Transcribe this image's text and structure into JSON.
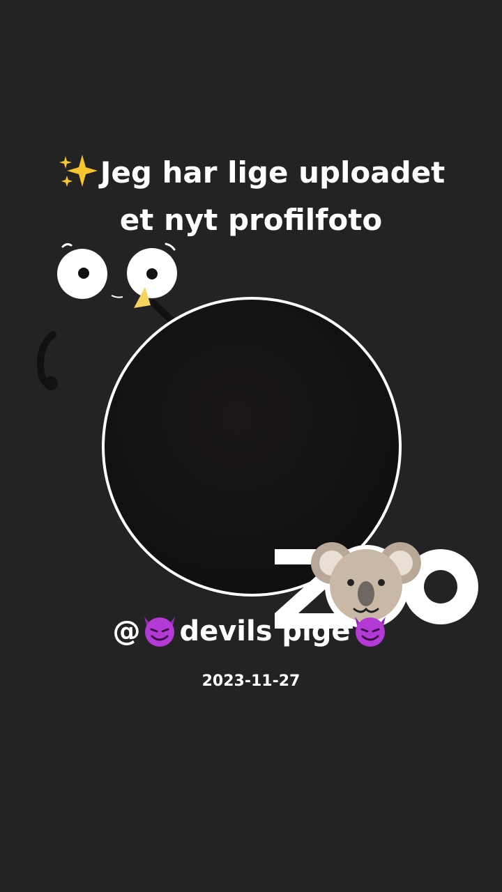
{
  "headline": {
    "line1": "Jeg har lige uploadet",
    "line2": "et nyt profilfoto",
    "sparkle_icon": "sparkles-icon"
  },
  "profile": {
    "username_prefix": "@",
    "username_name": "devils pige",
    "emoji_icon": "smiling-devil-icon",
    "date": "2023-11-27"
  },
  "sticker": {
    "logo_text": "ZOO",
    "mascot_icon": "koala-icon"
  },
  "colors": {
    "background": "#232323",
    "text": "#ffffff",
    "devil_purple": "#b43ad6",
    "sparkle_yellow": "#f7c531",
    "koala_fur": "#c9b8a6"
  }
}
